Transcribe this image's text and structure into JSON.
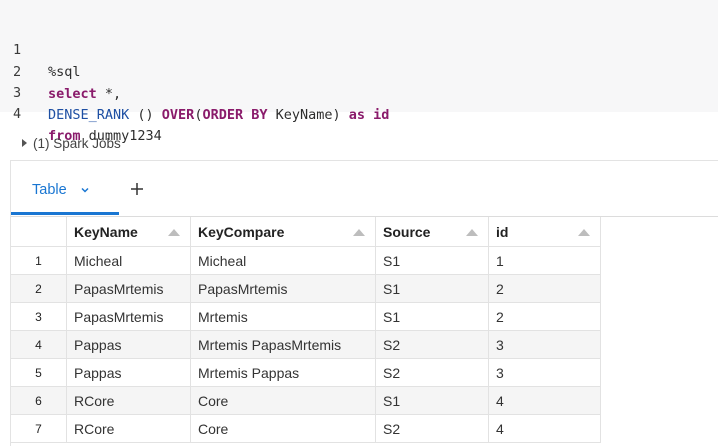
{
  "code": {
    "lines": [
      {
        "n": "1",
        "segs": [
          {
            "t": "%sql",
            "c": "plain"
          }
        ]
      },
      {
        "n": "2",
        "segs": [
          {
            "t": "select",
            "c": "kw"
          },
          {
            "t": " *,",
            "c": "plain"
          }
        ]
      },
      {
        "n": "3",
        "segs": [
          {
            "t": "DENSE_RANK",
            "c": "fn"
          },
          {
            "t": " () ",
            "c": "plain"
          },
          {
            "t": "OVER",
            "c": "kw"
          },
          {
            "t": "(",
            "c": "plain"
          },
          {
            "t": "ORDER BY",
            "c": "kw"
          },
          {
            "t": " KeyName) ",
            "c": "plain"
          },
          {
            "t": "as",
            "c": "kw"
          },
          {
            "t": " ",
            "c": "plain"
          },
          {
            "t": "id",
            "c": "kw"
          }
        ]
      },
      {
        "n": "4",
        "segs": [
          {
            "t": "from",
            "c": "kw"
          },
          {
            "t": " dummy1234",
            "c": "plain"
          }
        ]
      }
    ]
  },
  "jobs": {
    "label": "(1) Spark Jobs"
  },
  "tabs": {
    "active_label": "Table"
  },
  "colors": {
    "accent": "#1976d2",
    "keyword": "#8a1b6b",
    "function": "#1e4fa3"
  },
  "table": {
    "headers": [
      "KeyName",
      "KeyCompare",
      "Source",
      "id"
    ],
    "rows": [
      [
        "1",
        "Micheal",
        "Micheal",
        "S1",
        "1"
      ],
      [
        "2",
        "PapasMrtemis",
        "PapasMrtemis",
        "S1",
        "2"
      ],
      [
        "3",
        "PapasMrtemis",
        "Mrtemis",
        "S1",
        "2"
      ],
      [
        "4",
        "Pappas",
        "Mrtemis PapasMrtemis",
        "S2",
        "3"
      ],
      [
        "5",
        "Pappas",
        "Mrtemis Pappas",
        "S2",
        "3"
      ],
      [
        "6",
        "RCore",
        "Core",
        "S1",
        "4"
      ],
      [
        "7",
        "RCore",
        "Core",
        "S2",
        "4"
      ]
    ]
  }
}
